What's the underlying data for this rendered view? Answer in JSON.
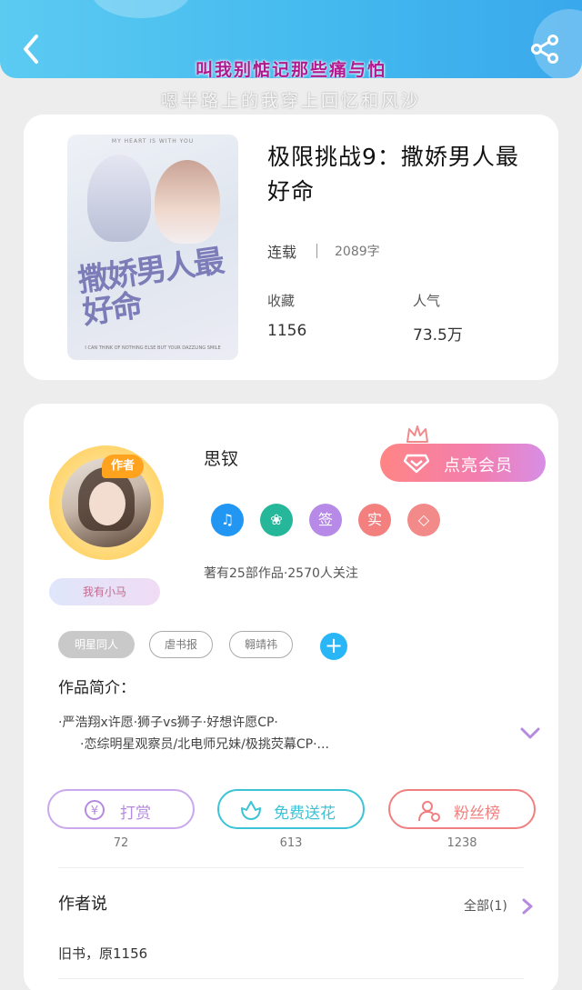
{
  "header": {
    "signature_line1": "叫我别惦记那些痛与怕",
    "signature_line2": "嗯半路上的我穿上回忆和风沙",
    "back_icon": "chevron-left-icon",
    "share_icon": "share-icon"
  },
  "book": {
    "title": "极限挑战9：撒娇男人最好命",
    "status": "连载",
    "word_count": "2089字",
    "favorites_label": "收藏",
    "favorites_value": "1156",
    "popularity_label": "人气",
    "popularity_value": "73.5万",
    "cover": {
      "top_text": "MY HEART IS WITH YOU",
      "title_text": "撒娇男人最好命",
      "bottom_text": "I CAN THINK OF NOTHING ELSE BUT YOUR DAZZLING SMILE"
    }
  },
  "author": {
    "tag": "作者",
    "ribbon_text": "我有小马",
    "name": "思钗",
    "vip_button": "点亮会员",
    "badges": [
      {
        "icon": "music-note-icon",
        "text": "♫",
        "color": "#2196f3"
      },
      {
        "icon": "handshake-icon",
        "text": "❀",
        "color": "#26b79a"
      },
      {
        "icon": "sign-badge-icon",
        "text": "签",
        "color": "#b68ae6"
      },
      {
        "icon": "real-name-badge-icon",
        "text": "实",
        "color": "#f47f7f"
      },
      {
        "icon": "diamond-badge-icon",
        "text": "◇",
        "color": "#f28a8a"
      }
    ],
    "works_line": "著有25部作品·2570人关注",
    "tags": [
      "明星同人",
      "虐书报",
      "翱靖祎"
    ],
    "intro_title": "作品简介：",
    "intro_lines": [
      "·严浩翔x许愿·狮子vs狮子·好想许愿CP·",
      "·恋综明星观察员/北电师兄妹/极挑荧幕CP·..."
    ]
  },
  "actions": [
    {
      "label": "打赏",
      "count": "72",
      "icon": "yen-coin-icon",
      "color": "#b58ae0"
    },
    {
      "label": "免费送花",
      "count": "613",
      "icon": "flower-icon",
      "color": "#3cc3d6"
    },
    {
      "label": "粉丝榜",
      "count": "1238",
      "icon": "fan-user-icon",
      "color": "#f08080"
    }
  ],
  "author_says": {
    "title": "作者说",
    "all_label": "全部(1)",
    "text": "旧书，原1156"
  }
}
